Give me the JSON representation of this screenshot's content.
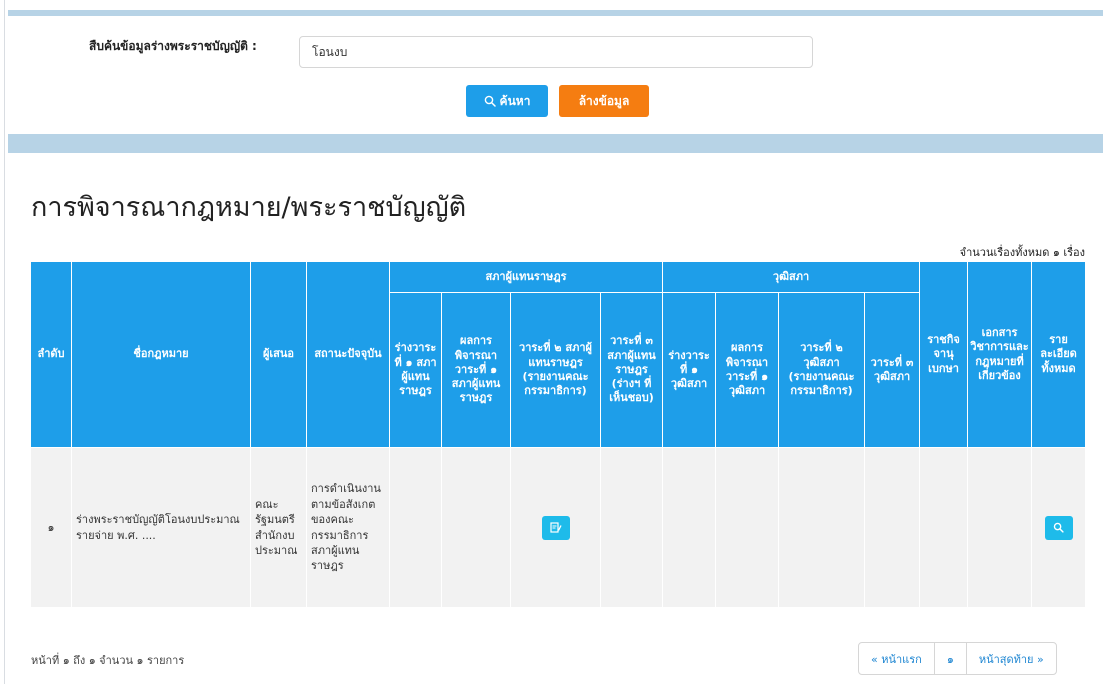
{
  "search": {
    "label": "สืบค้นข้อมูลร่างพระราชบัญญัติ :",
    "value": "โอนงบ",
    "search_button": "ค้นหา",
    "clear_button": "ล้างข้อมูล"
  },
  "page": {
    "title": "การพิจารณากฎหมาย/พระราชบัญญัติ",
    "total_count": "จำนวนเรื่องทั้งหมด ๑ เรื่อง"
  },
  "table": {
    "headers": {
      "no": "ลำดับ",
      "law_name": "ชื่อกฎหมาย",
      "proposer": "ผู้เสนอ",
      "status": "สถานะปัจจุบัน",
      "house_group": "สภาผู้แทนราษฎร",
      "senate_group": "วุฒิสภา",
      "h_draft_r1": "ร่างวาระที่ ๑ สภาผู้แทนราษฎร",
      "h_result_r1": "ผลการพิจารณาวาระที่ ๑ สภาผู้แทนราษฎร",
      "h_r2": "วาระที่ ๒ สภาผู้แทนราษฎร (รายงานคณะกรรมาธิการ)",
      "h_r3": "วาระที่ ๓ สภาผู้แทนราษฎร (ร่างฯ ที่เห็นชอบ)",
      "s_draft_r1": "ร่างวาระที่ ๑ วุฒิสภา",
      "s_result_r1": "ผลการพิจารณาวาระที่ ๑ วุฒิสภา",
      "s_r2": "วาระที่ ๒ วุฒิสภา (รายงานคณะกรรมาธิการ)",
      "s_r3": "วาระที่ ๓ วุฒิสภา",
      "gazette": "ราชกิจจานุเบกษา",
      "documents": "เอกสารวิชาการและกฎหมายที่เกี่ยวข้อง",
      "details": "รายละเอียดทั้งหมด"
    },
    "rows": [
      {
        "no": "๑",
        "law_name": "ร่างพระราชบัญญัติโอนงบประมาณรายจ่าย พ.ศ. ....",
        "proposer": "คณะรัฐมนตรี สำนักงบประมาณ",
        "status": "การดำเนินงานตามข้อสังเกตของคณะกรรมาธิการสภาผู้แทนราษฎร",
        "r2_icon": "edit-note-icon",
        "details_icon": "search-icon"
      }
    ]
  },
  "pagination": {
    "info": "หน้าที่ ๑ ถึง ๑ จำนวน ๑ รายการ",
    "first": "« หน้าแรก",
    "current": "๑",
    "last": "หน้าสุดท้าย »"
  },
  "colors": {
    "header_blue": "#1e9ee9",
    "clear_orange": "#f57d11",
    "band_blue": "#b7d3e6",
    "row_gray": "#f2f2f2",
    "mini_button": "#1ebbea"
  }
}
